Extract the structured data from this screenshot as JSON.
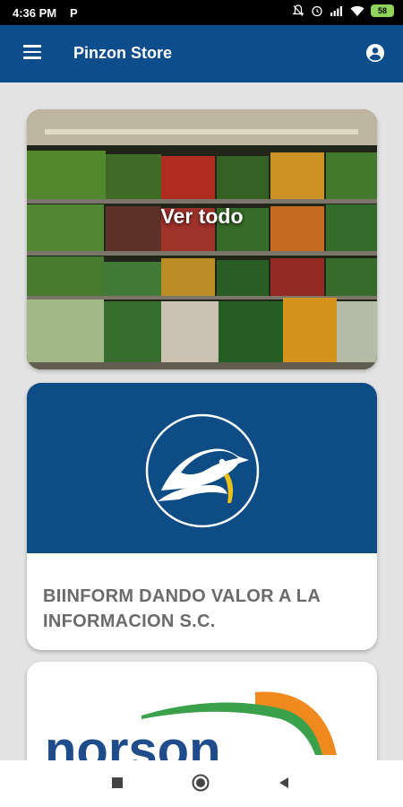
{
  "status_bar": {
    "time": "4:36 PM",
    "app_indicator": "P",
    "battery_level": "58"
  },
  "app_bar": {
    "title": "Pinzon Store",
    "menu_icon": "hamburger-menu-icon",
    "account_icon": "account-circle-icon"
  },
  "cards": {
    "produce": {
      "label": "Ver todo"
    },
    "biinform": {
      "name": "BIINFORM DANDO VALOR A LA INFORMACION S.C."
    },
    "norson": {
      "logo_text": "norson"
    }
  },
  "colors": {
    "primary": "#0e4d8c",
    "banner": "#0d4c84",
    "card_text": "#6b6b6b",
    "norson_blue": "#1f4d8c",
    "norson_orange": "#f0891e",
    "norson_green": "#3aa14a"
  }
}
